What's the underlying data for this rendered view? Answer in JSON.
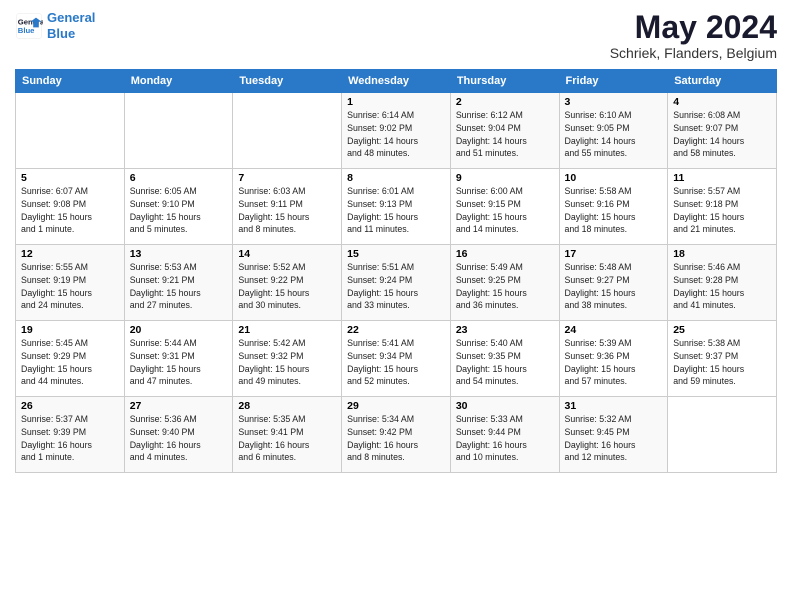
{
  "logo": {
    "line1": "General",
    "line2": "Blue"
  },
  "title": "May 2024",
  "subtitle": "Schriek, Flanders, Belgium",
  "weekdays": [
    "Sunday",
    "Monday",
    "Tuesday",
    "Wednesday",
    "Thursday",
    "Friday",
    "Saturday"
  ],
  "weeks": [
    [
      {
        "day": "",
        "info": ""
      },
      {
        "day": "",
        "info": ""
      },
      {
        "day": "",
        "info": ""
      },
      {
        "day": "1",
        "info": "Sunrise: 6:14 AM\nSunset: 9:02 PM\nDaylight: 14 hours\nand 48 minutes."
      },
      {
        "day": "2",
        "info": "Sunrise: 6:12 AM\nSunset: 9:04 PM\nDaylight: 14 hours\nand 51 minutes."
      },
      {
        "day": "3",
        "info": "Sunrise: 6:10 AM\nSunset: 9:05 PM\nDaylight: 14 hours\nand 55 minutes."
      },
      {
        "day": "4",
        "info": "Sunrise: 6:08 AM\nSunset: 9:07 PM\nDaylight: 14 hours\nand 58 minutes."
      }
    ],
    [
      {
        "day": "5",
        "info": "Sunrise: 6:07 AM\nSunset: 9:08 PM\nDaylight: 15 hours\nand 1 minute."
      },
      {
        "day": "6",
        "info": "Sunrise: 6:05 AM\nSunset: 9:10 PM\nDaylight: 15 hours\nand 5 minutes."
      },
      {
        "day": "7",
        "info": "Sunrise: 6:03 AM\nSunset: 9:11 PM\nDaylight: 15 hours\nand 8 minutes."
      },
      {
        "day": "8",
        "info": "Sunrise: 6:01 AM\nSunset: 9:13 PM\nDaylight: 15 hours\nand 11 minutes."
      },
      {
        "day": "9",
        "info": "Sunrise: 6:00 AM\nSunset: 9:15 PM\nDaylight: 15 hours\nand 14 minutes."
      },
      {
        "day": "10",
        "info": "Sunrise: 5:58 AM\nSunset: 9:16 PM\nDaylight: 15 hours\nand 18 minutes."
      },
      {
        "day": "11",
        "info": "Sunrise: 5:57 AM\nSunset: 9:18 PM\nDaylight: 15 hours\nand 21 minutes."
      }
    ],
    [
      {
        "day": "12",
        "info": "Sunrise: 5:55 AM\nSunset: 9:19 PM\nDaylight: 15 hours\nand 24 minutes."
      },
      {
        "day": "13",
        "info": "Sunrise: 5:53 AM\nSunset: 9:21 PM\nDaylight: 15 hours\nand 27 minutes."
      },
      {
        "day": "14",
        "info": "Sunrise: 5:52 AM\nSunset: 9:22 PM\nDaylight: 15 hours\nand 30 minutes."
      },
      {
        "day": "15",
        "info": "Sunrise: 5:51 AM\nSunset: 9:24 PM\nDaylight: 15 hours\nand 33 minutes."
      },
      {
        "day": "16",
        "info": "Sunrise: 5:49 AM\nSunset: 9:25 PM\nDaylight: 15 hours\nand 36 minutes."
      },
      {
        "day": "17",
        "info": "Sunrise: 5:48 AM\nSunset: 9:27 PM\nDaylight: 15 hours\nand 38 minutes."
      },
      {
        "day": "18",
        "info": "Sunrise: 5:46 AM\nSunset: 9:28 PM\nDaylight: 15 hours\nand 41 minutes."
      }
    ],
    [
      {
        "day": "19",
        "info": "Sunrise: 5:45 AM\nSunset: 9:29 PM\nDaylight: 15 hours\nand 44 minutes."
      },
      {
        "day": "20",
        "info": "Sunrise: 5:44 AM\nSunset: 9:31 PM\nDaylight: 15 hours\nand 47 minutes."
      },
      {
        "day": "21",
        "info": "Sunrise: 5:42 AM\nSunset: 9:32 PM\nDaylight: 15 hours\nand 49 minutes."
      },
      {
        "day": "22",
        "info": "Sunrise: 5:41 AM\nSunset: 9:34 PM\nDaylight: 15 hours\nand 52 minutes."
      },
      {
        "day": "23",
        "info": "Sunrise: 5:40 AM\nSunset: 9:35 PM\nDaylight: 15 hours\nand 54 minutes."
      },
      {
        "day": "24",
        "info": "Sunrise: 5:39 AM\nSunset: 9:36 PM\nDaylight: 15 hours\nand 57 minutes."
      },
      {
        "day": "25",
        "info": "Sunrise: 5:38 AM\nSunset: 9:37 PM\nDaylight: 15 hours\nand 59 minutes."
      }
    ],
    [
      {
        "day": "26",
        "info": "Sunrise: 5:37 AM\nSunset: 9:39 PM\nDaylight: 16 hours\nand 1 minute."
      },
      {
        "day": "27",
        "info": "Sunrise: 5:36 AM\nSunset: 9:40 PM\nDaylight: 16 hours\nand 4 minutes."
      },
      {
        "day": "28",
        "info": "Sunrise: 5:35 AM\nSunset: 9:41 PM\nDaylight: 16 hours\nand 6 minutes."
      },
      {
        "day": "29",
        "info": "Sunrise: 5:34 AM\nSunset: 9:42 PM\nDaylight: 16 hours\nand 8 minutes."
      },
      {
        "day": "30",
        "info": "Sunrise: 5:33 AM\nSunset: 9:44 PM\nDaylight: 16 hours\nand 10 minutes."
      },
      {
        "day": "31",
        "info": "Sunrise: 5:32 AM\nSunset: 9:45 PM\nDaylight: 16 hours\nand 12 minutes."
      },
      {
        "day": "",
        "info": ""
      }
    ]
  ]
}
